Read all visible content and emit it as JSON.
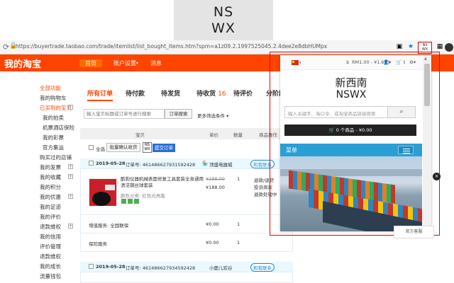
{
  "logo": {
    "line1": "NS",
    "line2": "WX"
  },
  "browser": {
    "url": "https://buyertrade.taobao.com/trade/itemlist/list_bought_items.htm?spm=a1z09.2.1997525045.2.4dee2e8dbHUMpx",
    "ext_label_1": "NS",
    "ext_label_2": "WX"
  },
  "header": {
    "brand": "我的淘宝",
    "nav": [
      "首页",
      "账户设置",
      "消息"
    ]
  },
  "sidebar": {
    "section_title": "全部功能",
    "items": [
      "我的购物车",
      "已买到的宝贝",
      "我的拍卖",
      "机票酒店保险",
      "我的彩票",
      "官方集运",
      "购买过的店铺",
      "我的发票",
      "我的收藏",
      "我的积分",
      "我的优惠",
      "我的足迹",
      "我的评价",
      "退款维权",
      "我的信用",
      "评价管理",
      "退款维权",
      "我的成长",
      "流量钱包"
    ]
  },
  "main": {
    "tabs": [
      {
        "label": "所有订单",
        "count": ""
      },
      {
        "label": "待付款",
        "count": ""
      },
      {
        "label": "待发货",
        "count": ""
      },
      {
        "label": "待收货",
        "count": "16"
      },
      {
        "label": "待评价",
        "count": ""
      },
      {
        "label": "分阶段",
        "count": ""
      }
    ],
    "search_placeholder": "输入宝贝标题或订单号进行搜索",
    "search_button": "订单搜索",
    "more_filters": "更多筛选条件",
    "table_headers": [
      "宝贝",
      "单价",
      "数量",
      "商品操作"
    ],
    "bulk": {
      "select_all": "全选",
      "confirm_btn": "批量确认收货",
      "ext_btn": "提交订单"
    },
    "orders": [
      {
        "date": "2019-05-28",
        "order_no": "订单号: 461486627931592428",
        "shop": "顶盛电器城",
        "contact": "和我联系",
        "title": "酷狗仪器机械表面修复工具套装全身通用清洁钢丝球套装",
        "spec": "颜色分类: 红色光亮版",
        "price_old": "¥188.00",
        "price_new": "¥188.00",
        "qty": "1",
        "actions": [
          "退款/退货",
          "投诉商家",
          "退款处理中"
        ],
        "service_label": "增值服务: 全国联保",
        "service_price": "¥0.00",
        "service_qty": "1",
        "insurance_label": "保险服务",
        "insurance_price": "¥0.00",
        "insurance_qty": "1"
      },
      {
        "date": "2019-05-28",
        "order_no": "订单号: 461486627934592428",
        "shop": "小鹿儿欢谷",
        "contact": "和我联系"
      }
    ]
  },
  "popup": {
    "currency": "RM1.00 - ¥1.653",
    "title_cn": "新西南",
    "title_en": "NSWX",
    "search_placeholder": "输入关键字、淘口令、或淘宝商品链接搜索",
    "cart": "0 个商品 - ¥0.00",
    "menu_label": "菜单"
  },
  "right_widget": "官方客服"
}
